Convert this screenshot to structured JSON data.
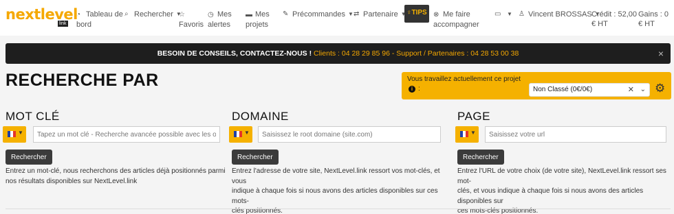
{
  "brand": {
    "logo_text": "nextlevel",
    "logo_sub": "link"
  },
  "nav": {
    "dashboard": {
      "icon": "gauge-icon",
      "line1": "Tableau de",
      "line2": "bord"
    },
    "search": {
      "icon": "search-icon",
      "label": "Rechercher"
    },
    "favorites": {
      "icon": "star-icon",
      "label": "Favoris"
    },
    "alerts": {
      "icon": "clock-icon",
      "line1": "Mes",
      "line2": "alertes"
    },
    "projects": {
      "icon": "folder-icon",
      "line1": "Mes",
      "line2": "projets"
    },
    "preorders": {
      "icon": "edit-icon",
      "label": "Précommandes"
    },
    "partner": {
      "icon": "handshake-icon",
      "label": "Partenaire"
    },
    "tips": {
      "icon": "lightbulb-icon",
      "label": "TIPS"
    },
    "support": {
      "icon": "life-ring-icon",
      "line1": "Me faire",
      "line2": "accompagner"
    },
    "messages": {
      "icon": "comment-icon"
    },
    "user": {
      "icon": "user-icon",
      "label": "Vincent BROSSAS"
    },
    "credit": {
      "line1": "Crédit : 52,00",
      "line2": "€ HT"
    },
    "gains": {
      "line1": "Gains : 0",
      "line2": "€ HT"
    }
  },
  "announce": {
    "lead": "BESOIN DE CONSEILS, CONTACTEZ-NOUS !",
    "contacts": "Clients : 04 28 29 85 96 - Support / Partenaires : 04 28 53 00 38",
    "close": "×"
  },
  "page_title": "RECHERCHE PAR",
  "project": {
    "label": "Vous travaillez actuellement ce projet",
    "colon": ":",
    "selected": "Non Classé (0€/0€)"
  },
  "columns": {
    "keyword": {
      "heading": "MOT CLÉ",
      "placeholder": "Tapez un mot clé - Recherche avancée possible avec les opérat",
      "button": "Rechercher",
      "help_line1": "Entrez un mot-clé, nous recherchons des articles déjà positionnés parmi",
      "help_line2": "nos résultats disponibles sur NextLevel.link"
    },
    "domain": {
      "heading": "DOMAINE",
      "placeholder": "Saisissez le root domaine (site.com)",
      "button": "Rechercher",
      "help_line1": "Entrez l'adresse de votre site, NextLevel.link ressort vos mot-clés, et vous",
      "help_line2": "indique à chaque fois si nous avons des articles disponibles sur ces mots-",
      "help_line3": "clés positionnés."
    },
    "page": {
      "heading": "PAGE",
      "placeholder": "Saisissez votre url",
      "button": "Rechercher",
      "help_line1": "Entrez l'URL de votre choix (de votre site), NextLevel.link ressort ses mot-",
      "help_line2": "clés, et vous indique à chaque fois si nous avons des articles disponibles sur",
      "help_line3": "ces mots-clés positionnés."
    }
  },
  "colors": {
    "accent": "#f5b100",
    "dark": "#1e1e1e",
    "flag_blue": "#1f3fa8",
    "flag_red": "#e63329"
  }
}
